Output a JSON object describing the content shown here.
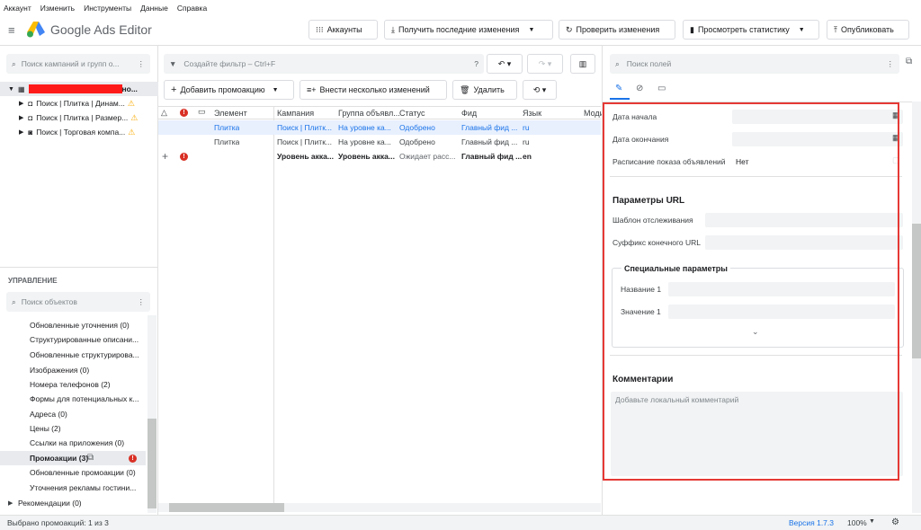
{
  "menu": [
    "Аккаунт",
    "Изменить",
    "Инструменты",
    "Данные",
    "Справка"
  ],
  "app_title": "Google Ads Editor",
  "toolbar": {
    "accounts": "Аккаунты",
    "get_changes": "Получить последние изменения",
    "check_changes": "Проверить изменения",
    "view_stats": "Просмотреть статистику",
    "publish": "Опубликовать"
  },
  "left": {
    "search_placeholder": "Поиск кампаний и групп о...",
    "account_suffix": "но...",
    "campaigns": [
      "Поиск | Плитка | Динам...",
      "Поиск | Плитка | Размер...",
      "Поиск | Торговая компа..."
    ],
    "management_title": "УПРАВЛЕНИЕ",
    "objects_placeholder": "Поиск объектов",
    "items": [
      "Обновленные уточнения (0)",
      "Структурированные описани...",
      "Обновленные структурирова...",
      "Изображения (0)",
      "Номера телефонов (2)",
      "Формы для потенциальных к...",
      "Адреса (0)",
      "Цены (2)",
      "Ссылки на приложения (0)",
      "Промоакции (3)",
      "Обновленные промоакции (0)",
      "Уточнения рекламы гостини...",
      "Рекомендации (0)"
    ]
  },
  "grid": {
    "filter_placeholder": "Создайте фильтр – Ctrl+F",
    "add_promo": "Добавить промоакцию",
    "bulk_changes": "Внести несколько изменений",
    "delete": "Удалить",
    "columns": [
      "Элемент",
      "Кампания",
      "Группа объявл...",
      "Статус",
      "Фид",
      "Язык",
      "Моди"
    ],
    "rows": [
      [
        "Плитка",
        "Поиск | Плитк...",
        "На уровне ка...",
        "Одобрено",
        "Главный фид ...",
        "ru"
      ],
      [
        "Плитка",
        "Поиск | Плитк...",
        "На уровне ка...",
        "Одобрено",
        "Главный фид ...",
        "ru"
      ],
      [
        "",
        "Уровень акка...",
        "Уровень акка...",
        "Ожидает расс...",
        "Главный фид ...",
        "en"
      ]
    ]
  },
  "right": {
    "search_placeholder": "Поиск полей",
    "start_date": "Дата начала",
    "end_date": "Дата окончания",
    "schedule": "Расписание показа объявлений",
    "schedule_value": "Нет",
    "url_params": "Параметры URL",
    "tracking_template": "Шаблон отслеживания",
    "final_url_suffix": "Суффикс конечного URL",
    "custom_params": "Специальные параметры",
    "name1": "Название 1",
    "value1": "Значение 1",
    "comments": "Комментарии",
    "comment_placeholder": "Добавьте локальный комментарий"
  },
  "status": {
    "selected": "Выбрано промоакций: 1 из 3",
    "version": "Версия 1.7.3",
    "zoom": "100%"
  }
}
